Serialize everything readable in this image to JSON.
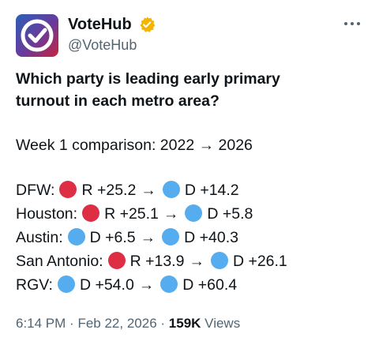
{
  "account": {
    "display_name": "VoteHub",
    "handle": "@VoteHub",
    "verified_icon": "verified-badge-icon",
    "avatar_icon": "checkmark-logo-icon"
  },
  "more_icon": "more-options-icon",
  "tweet": {
    "title_line1": "Which party is leading early primary",
    "title_line2": "turnout in each metro area?",
    "subtitle": "Week 1 comparison: 2022 → 2026",
    "rows": [
      {
        "label": "DFW:",
        "from_party": "red",
        "from_value": "R +25.2",
        "arrow": "→",
        "to_party": "blue",
        "to_value": "D +14.2"
      },
      {
        "label": "Houston:",
        "from_party": "red",
        "from_value": "R +25.1",
        "arrow": "→",
        "to_party": "blue",
        "to_value": "D +5.8"
      },
      {
        "label": "Austin:",
        "from_party": "blue",
        "from_value": "D +6.5",
        "arrow": "→",
        "to_party": "blue",
        "to_value": "D +40.3"
      },
      {
        "label": "San Antonio:",
        "from_party": "red",
        "from_value": "R +13.9",
        "arrow": "→",
        "to_party": "blue",
        "to_value": "D +26.1"
      },
      {
        "label": "RGV:",
        "from_party": "blue",
        "from_value": "D +54.0",
        "arrow": "→",
        "to_party": "blue",
        "to_value": "D +60.4"
      }
    ]
  },
  "footer": {
    "time": "6:14 PM",
    "separator": "·",
    "date": "Feb 22, 2026",
    "views_count": "159K",
    "views_label": "Views"
  },
  "colors": {
    "red_dot": "#dd2e44",
    "blue_dot": "#55acee",
    "verified": "#f4b400",
    "muted_text": "#536471"
  }
}
